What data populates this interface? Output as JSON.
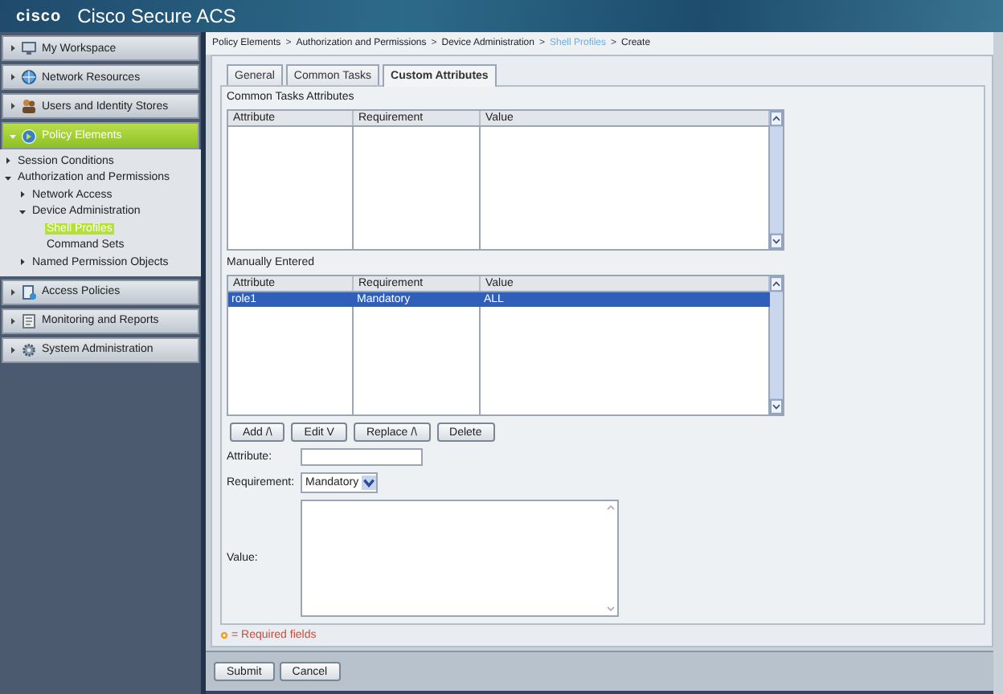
{
  "header": {
    "logo": "cisco",
    "title": "Cisco Secure ACS"
  },
  "sidebar": {
    "sections": [
      {
        "label": "My Workspace",
        "selected": false,
        "expanded": false
      },
      {
        "label": "Network Resources",
        "selected": false,
        "expanded": false
      },
      {
        "label": "Users and Identity Stores",
        "selected": false,
        "expanded": false
      },
      {
        "label": "Policy Elements",
        "selected": true,
        "expanded": true,
        "children": [
          {
            "label": "Session Conditions",
            "selected": false,
            "expanded": false
          },
          {
            "label": "Authorization and Permissions",
            "selected": false,
            "expanded": true,
            "children": [
              {
                "label": "Network Access",
                "selected": false,
                "expanded": false
              },
              {
                "label": "Device Administration",
                "selected": false,
                "expanded": true,
                "children": [
                  {
                    "label": "Shell Profiles",
                    "selected": true
                  },
                  {
                    "label": "Command Sets",
                    "selected": false
                  }
                ]
              },
              {
                "label": "Named Permission Objects",
                "selected": false,
                "expanded": false
              }
            ]
          }
        ]
      },
      {
        "label": "Access Policies",
        "selected": false,
        "expanded": false
      },
      {
        "label": "Monitoring and Reports",
        "selected": false,
        "expanded": false
      },
      {
        "label": "System Administration",
        "selected": false,
        "expanded": false
      }
    ]
  },
  "breadcrumb": {
    "separator": ">",
    "items": [
      {
        "label": "Policy Elements",
        "current": false
      },
      {
        "label": "Authorization and Permissions",
        "current": false
      },
      {
        "label": "Device Administration",
        "current": false
      },
      {
        "label": "Shell Profiles",
        "current": true
      },
      {
        "label": "Create",
        "current": false
      }
    ]
  },
  "tabs": [
    {
      "label": "General",
      "selected": false
    },
    {
      "label": "Common Tasks",
      "selected": false
    },
    {
      "label": "Custom Attributes",
      "selected": true
    }
  ],
  "tables": [
    {
      "title": "Common Tasks Attributes",
      "columns": [
        "Attribute",
        "Requirement",
        "Value"
      ]
    },
    {
      "title": "Manually Entered",
      "columns": [
        "Attribute",
        "Requirement",
        "Value"
      ],
      "rows": [
        {
          "cells": [
            "role1",
            "Mandatory",
            "ALL"
          ],
          "selected": true
        }
      ]
    }
  ],
  "table_buttons": [
    "Add /\\",
    "Edit V",
    "Replace /\\",
    "Delete"
  ],
  "form": {
    "attribute": {
      "label": "Attribute:"
    },
    "requirement": {
      "label": "Requirement:",
      "value": "Mandatory"
    },
    "value": {
      "label": "Value:"
    }
  },
  "required_note": "= Required fields",
  "footer_buttons": [
    "Submit",
    "Cancel"
  ]
}
